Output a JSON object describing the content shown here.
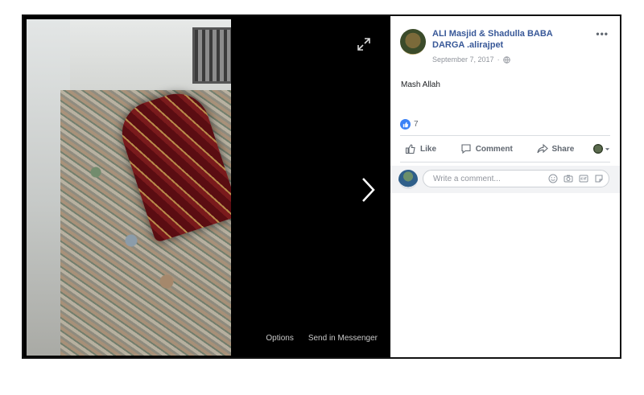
{
  "post": {
    "author": "ALI Masjid & Shadulla BABA DARGA .alirajpet",
    "date": "September 7, 2017",
    "text": "Mash Allah",
    "reaction_count": "7"
  },
  "actions": {
    "like": "Like",
    "comment": "Comment",
    "share": "Share"
  },
  "comment_input": {
    "placeholder": "Write a comment..."
  },
  "viewer": {
    "options": "Options",
    "send": "Send in Messenger"
  },
  "icons": [
    "expand-icon",
    "chevron-right-icon",
    "more-icon",
    "globe-icon",
    "like-icon",
    "comment-icon",
    "share-icon",
    "emoji-icon",
    "camera-icon",
    "gif-icon",
    "sticker-icon"
  ],
  "colors": {
    "link": "#385898",
    "like_blue": "#3b82f6",
    "muted": "#90949c"
  }
}
